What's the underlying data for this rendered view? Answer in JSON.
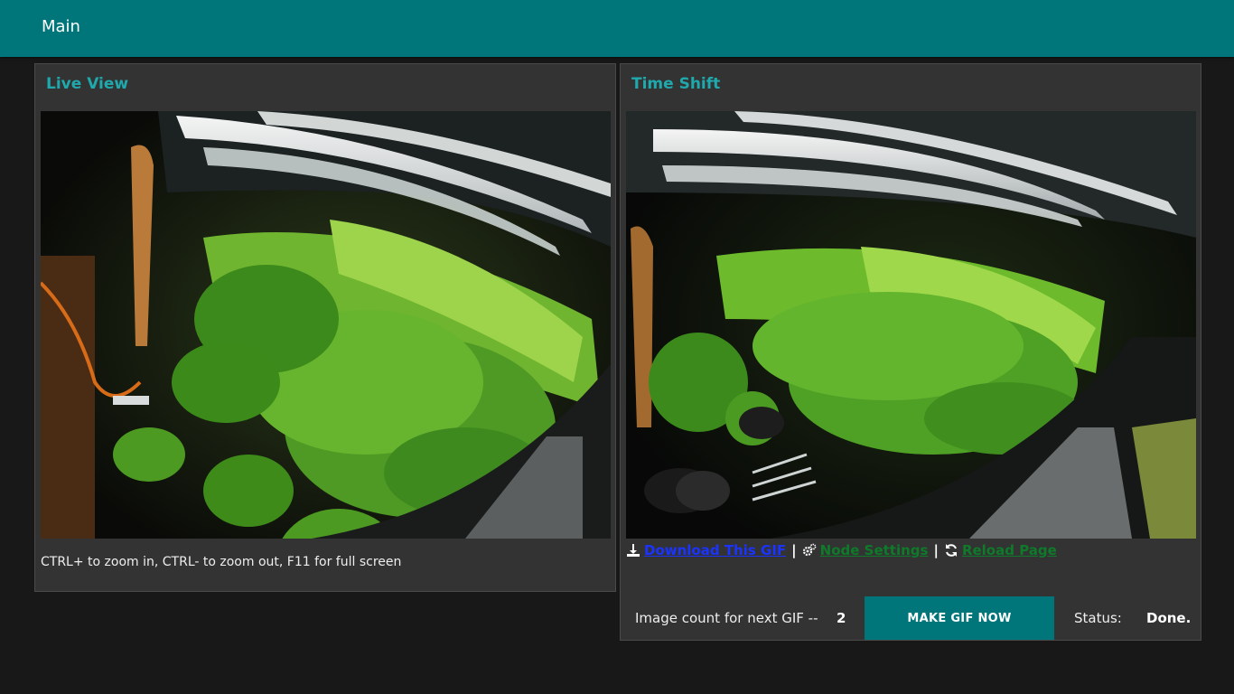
{
  "header": {
    "title": "Main"
  },
  "live_view": {
    "title": "Live View",
    "hint": "CTRL+ to zoom in, CTRL- to zoom out, F11 for full screen",
    "image_icon": "camera-feed-image"
  },
  "time_shift": {
    "title": "Time Shift",
    "image_icon": "timelapse-gif-image",
    "links": {
      "download_label": "Download This GIF",
      "download_icon": "download-icon",
      "node_label": "Node Settings",
      "node_icon": "gears-icon",
      "reload_label": "Reload Page",
      "reload_icon": "refresh-icon",
      "separator": "|"
    },
    "image_count_label": "Image count for next GIF --",
    "image_count_value": "2",
    "make_gif_label": "MAKE GIF NOW",
    "status_label": "Status:",
    "status_value": "Done."
  },
  "colors": {
    "accent": "#00767a",
    "title_text": "#1fa9ad",
    "link_blue": "#1a33ff",
    "link_green": "#0e7a2a",
    "background": "#181818",
    "card": "#333333"
  }
}
